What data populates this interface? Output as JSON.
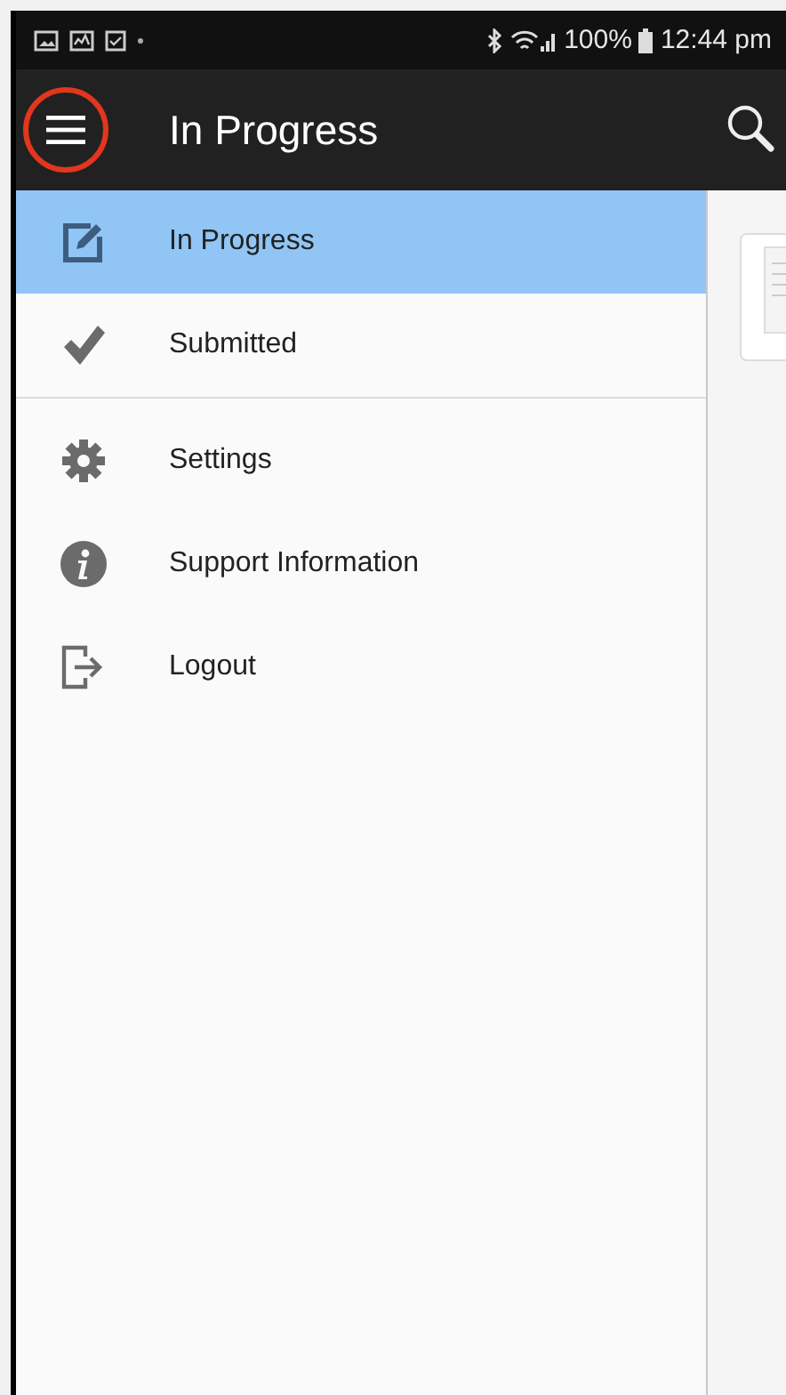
{
  "status_bar": {
    "battery": "100%",
    "time": "12:44 pm"
  },
  "toolbar": {
    "title": "In Progress"
  },
  "drawer": {
    "sections": [
      [
        {
          "label": "In Progress",
          "selected": true
        },
        {
          "label": "Submitted",
          "selected": false
        }
      ],
      [
        {
          "label": "Settings",
          "selected": false
        },
        {
          "label": "Support Information",
          "selected": false
        },
        {
          "label": "Logout",
          "selected": false
        }
      ]
    ]
  }
}
